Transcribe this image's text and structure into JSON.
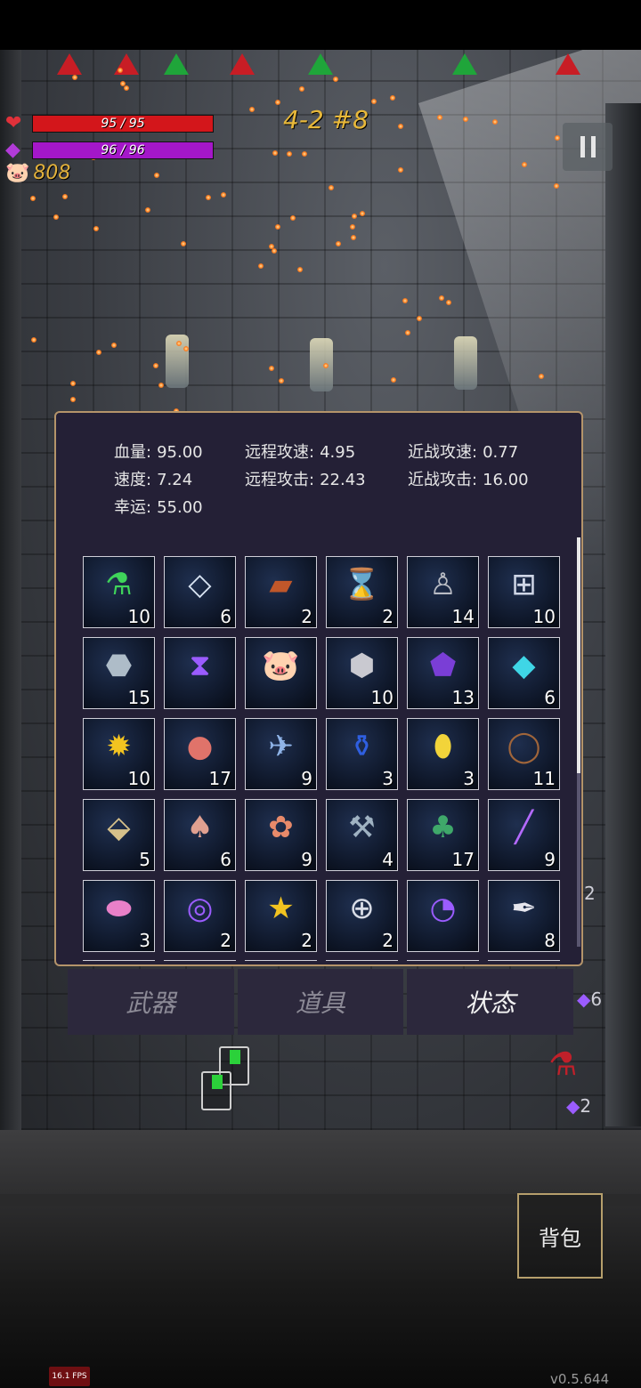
{
  "hud": {
    "hp_text": "95 / 95",
    "hp_fraction": 1.0,
    "mp_text": "96 / 96",
    "mp_fraction": 1.0,
    "coins": "808",
    "level": "4-2 #8",
    "pause_icon": "pause-icon",
    "colors": {
      "hp": "#d3161b",
      "mp": "#a417c9",
      "coins": "#e3b23c",
      "level": "#e8b83a"
    }
  },
  "stats": {
    "hp_label": "血量:",
    "hp_value": "95.00",
    "speed_label": "速度:",
    "speed_value": "7.24",
    "luck_label": "幸运:",
    "luck_value": "55.00",
    "ranged_speed_label": "远程攻速:",
    "ranged_speed_value": "4.95",
    "ranged_attack_label": "远程攻击:",
    "ranged_attack_value": "22.43",
    "melee_speed_label": "近战攻速:",
    "melee_speed_value": "0.77",
    "melee_attack_label": "近战攻击:",
    "melee_attack_value": "16.00"
  },
  "items": [
    {
      "icon": "green-potion-icon",
      "glyph": "⚗",
      "color": "#3fd45a",
      "count": "10"
    },
    {
      "icon": "crystal-plate-icon",
      "glyph": "◇",
      "color": "#d9e4f2",
      "count": "6"
    },
    {
      "icon": "spellbook-icon",
      "glyph": "▰",
      "color": "#c0572a",
      "count": "2"
    },
    {
      "icon": "hourglass-card-icon",
      "glyph": "⌛",
      "color": "#e6d36a",
      "count": "2"
    },
    {
      "icon": "hooded-statue-icon",
      "glyph": "♙",
      "color": "#b9bcc4",
      "count": "14"
    },
    {
      "icon": "medkit-icon",
      "glyph": "⊞",
      "color": "#cfd6e6",
      "count": "10"
    },
    {
      "icon": "stone-icon",
      "glyph": "⬣",
      "color": "#aebcc8",
      "count": "15"
    },
    {
      "icon": "purple-hourglass-icon",
      "glyph": "⧗",
      "color": "#9b5cff",
      "count": ""
    },
    {
      "icon": "piggy-bank-icon",
      "glyph": "🐷",
      "color": "#f2a6b4",
      "count": ""
    },
    {
      "icon": "silver-ore-icon",
      "glyph": "⬢",
      "color": "#c9c9d0",
      "count": "10"
    },
    {
      "icon": "purple-gem-icon",
      "glyph": "⬟",
      "color": "#7a3ed6",
      "count": "13"
    },
    {
      "icon": "cyan-crystal-icon",
      "glyph": "◆",
      "color": "#3fd6e6",
      "count": "6"
    },
    {
      "icon": "gold-coin-icon",
      "glyph": "✹",
      "color": "#f2c320",
      "count": "10"
    },
    {
      "icon": "apple-icon",
      "glyph": "●",
      "color": "#e0736a",
      "count": "17"
    },
    {
      "icon": "dragonfly-icon",
      "glyph": "✈",
      "color": "#8fb4e8",
      "count": "9"
    },
    {
      "icon": "blue-potion-icon",
      "glyph": "⚱",
      "color": "#2f5fe0",
      "count": "3"
    },
    {
      "icon": "yellow-crystal-icon",
      "glyph": "⬮",
      "color": "#f2d43a",
      "count": "3"
    },
    {
      "icon": "thorn-crown-icon",
      "glyph": "◯",
      "color": "#a0653a",
      "count": "11"
    },
    {
      "icon": "ore-chunks-icon",
      "glyph": "⬙",
      "color": "#d6c08a",
      "count": "5"
    },
    {
      "icon": "mushroom-icon",
      "glyph": "♠",
      "color": "#e0a090",
      "count": "6"
    },
    {
      "icon": "flower-cluster-icon",
      "glyph": "✿",
      "color": "#e88a6a",
      "count": "9"
    },
    {
      "icon": "hammer-icon",
      "glyph": "⚒",
      "color": "#9fb2c2",
      "count": "4"
    },
    {
      "icon": "clover-icon",
      "glyph": "♣",
      "color": "#3fa86a",
      "count": "17"
    },
    {
      "icon": "magic-wand-icon",
      "glyph": "╱",
      "color": "#b46aff",
      "count": "9"
    },
    {
      "icon": "pink-slime-icon",
      "glyph": "⬬",
      "color": "#e880c8",
      "count": "3"
    },
    {
      "icon": "purple-spiral-icon",
      "glyph": "◎",
      "color": "#9b5cff",
      "count": "2"
    },
    {
      "icon": "star-trophy-icon",
      "glyph": "★",
      "color": "#f2c320",
      "count": "2"
    },
    {
      "icon": "health-ring-icon",
      "glyph": "⊕",
      "color": "#d8dce6",
      "count": "2"
    },
    {
      "icon": "speed-gauge-icon",
      "glyph": "◔",
      "color": "#9b5cff",
      "count": ""
    },
    {
      "icon": "feather-icon",
      "glyph": "✒",
      "color": "#e6e6ee",
      "count": "8"
    }
  ],
  "tabs": [
    {
      "label": "武器",
      "active": false
    },
    {
      "label": "道具",
      "active": false
    },
    {
      "label": "状态",
      "active": true
    }
  ],
  "side_slots": {
    "slot_a": "2",
    "slot_b": "6",
    "slot_c": "2"
  },
  "bag_button": "背包",
  "fps": "16.1 FPS",
  "version": "v0.5.644"
}
